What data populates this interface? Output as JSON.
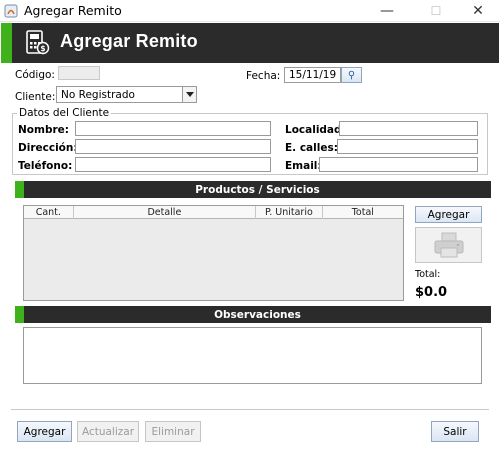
{
  "window": {
    "title": "Agregar Remito",
    "minimize_glyph": "—",
    "maximize_glyph": "☐",
    "close_glyph": "✕"
  },
  "header": {
    "title": "Agregar Remito",
    "accent_color": "#3fb21b",
    "background": "#2b2b2b",
    "icon": "cash-register-icon"
  },
  "form": {
    "codigo_label": "Código:",
    "codigo_value": "",
    "fecha_label": "Fecha:",
    "fecha_value": "15/11/19",
    "fecha_button_glyph": "⚲",
    "cliente_label": "Cliente:",
    "cliente_selected": "No Registrado"
  },
  "client_data": {
    "title": "Datos del Cliente",
    "nombre_label": "Nombre:",
    "nombre_value": "",
    "direccion_label": "Dirección:",
    "direccion_value": "",
    "telefono_label": "Teléfono:",
    "telefono_value": "",
    "localidad_label": "Localidad:",
    "localidad_value": "",
    "ecalles_label": "E. calles:",
    "ecalles_value": "",
    "email_label": "Email:",
    "email_value": ""
  },
  "products": {
    "section_title": "Productos / Servicios",
    "columns": [
      "Cant.",
      "Detalle",
      "P. Unitario",
      "Total"
    ],
    "rows": [],
    "agregar_label": "Agregar",
    "print_icon": "printer-icon",
    "total_label": "Total:",
    "total_value": "$0.0"
  },
  "observations": {
    "section_title": "Observaciones",
    "value": ""
  },
  "footer": {
    "agregar_label": "Agregar",
    "actualizar_label": "Actualizar",
    "eliminar_label": "Eliminar",
    "salir_label": "Salir"
  }
}
